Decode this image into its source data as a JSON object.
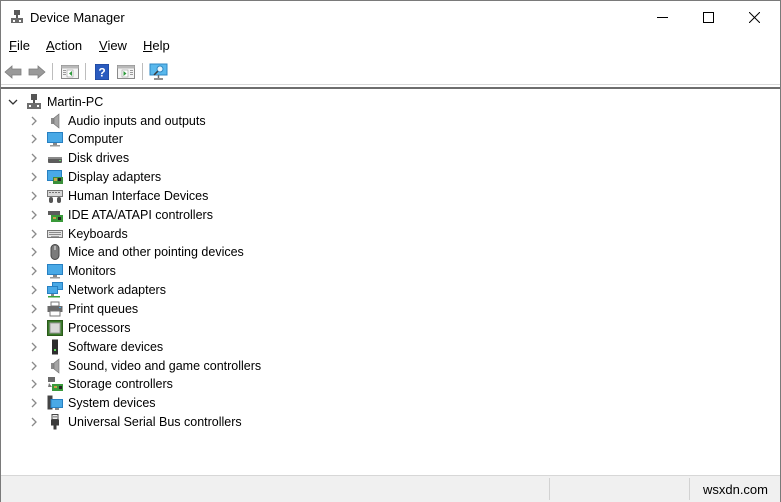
{
  "window": {
    "title": "Device Manager",
    "controls": {
      "minimize": "minimize",
      "maximize": "maximize",
      "close": "close"
    }
  },
  "menubar": {
    "items": [
      {
        "label": "File",
        "mnemonic": "F",
        "rest": "ile"
      },
      {
        "label": "Action",
        "mnemonic": "A",
        "rest": "ction"
      },
      {
        "label": "View",
        "mnemonic": "V",
        "rest": "iew"
      },
      {
        "label": "Help",
        "mnemonic": "H",
        "rest": "elp"
      }
    ]
  },
  "toolbar": {
    "buttons": [
      {
        "name": "back",
        "icon": "back-arrow-icon"
      },
      {
        "name": "forward",
        "icon": "forward-arrow-icon"
      },
      {
        "name": "show-hide-console-tree",
        "icon": "console-tree-icon"
      },
      {
        "name": "help",
        "icon": "help-icon"
      },
      {
        "name": "show-action-pane",
        "icon": "action-pane-icon"
      },
      {
        "name": "scan-hardware-changes",
        "icon": "scan-monitor-icon"
      }
    ]
  },
  "tree": {
    "root": {
      "label": "Martin-PC",
      "expanded": true,
      "icon": "computer-network-icon"
    },
    "children": [
      {
        "label": "Audio inputs and outputs",
        "icon": "speaker-icon"
      },
      {
        "label": "Computer",
        "icon": "computer-monitor-icon"
      },
      {
        "label": "Disk drives",
        "icon": "disk-drive-icon"
      },
      {
        "label": "Display adapters",
        "icon": "display-adapter-icon"
      },
      {
        "label": "Human Interface Devices",
        "icon": "hid-icon"
      },
      {
        "label": "IDE ATA/ATAPI controllers",
        "icon": "ide-controller-icon"
      },
      {
        "label": "Keyboards",
        "icon": "keyboard-icon"
      },
      {
        "label": "Mice and other pointing devices",
        "icon": "mouse-icon"
      },
      {
        "label": "Monitors",
        "icon": "monitor-icon"
      },
      {
        "label": "Network adapters",
        "icon": "network-adapter-icon"
      },
      {
        "label": "Print queues",
        "icon": "printer-icon"
      },
      {
        "label": "Processors",
        "icon": "processor-icon"
      },
      {
        "label": "Software devices",
        "icon": "software-device-icon"
      },
      {
        "label": "Sound, video and game controllers",
        "icon": "sound-controller-icon"
      },
      {
        "label": "Storage controllers",
        "icon": "storage-controller-icon"
      },
      {
        "label": "System devices",
        "icon": "system-devices-icon"
      },
      {
        "label": "Universal Serial Bus controllers",
        "icon": "usb-icon"
      }
    ]
  },
  "statusbar": {
    "panes": [
      "",
      "",
      "wsxdn.com"
    ]
  }
}
